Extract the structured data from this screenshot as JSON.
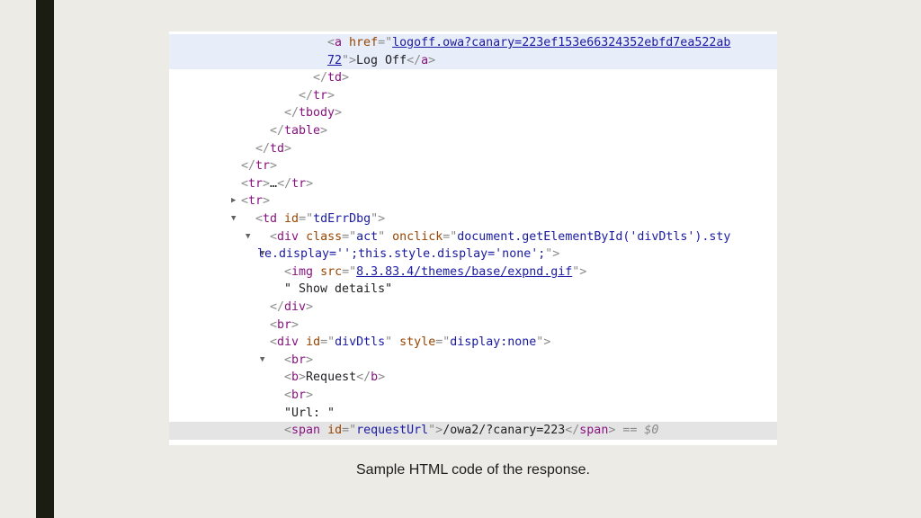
{
  "lines": {
    "l0": {
      "t1": "<",
      "name": "a",
      "sp": " ",
      "attr": "href",
      "eq": "=\"",
      "link": "logoff.owa?canary=223ef153e66324352ebfd7ea522ab",
      "q": "\""
    },
    "l1": {
      "link": "72",
      "q": "\">",
      "text": "Log Off",
      "close_open": "</",
      "name": "a",
      "close": ">"
    },
    "l2": {
      "open": "</",
      "name": "td",
      "close": ">"
    },
    "l3": {
      "open": "</",
      "name": "tr",
      "close": ">"
    },
    "l4": {
      "open": "</",
      "name": "tbody",
      "close": ">"
    },
    "l5": {
      "open": "</",
      "name": "table",
      "close": ">"
    },
    "l6": {
      "open": "</",
      "name": "td",
      "close": ">"
    },
    "l7": {
      "open": "</",
      "name": "tr",
      "close": ">"
    },
    "l8": {
      "open": "<",
      "name": "tr",
      "close": ">",
      "ellipsis": "…",
      "open2": "</",
      "name2": "tr",
      "close2": ">"
    },
    "l9": {
      "open": "<",
      "name": "tr",
      "close": ">"
    },
    "l10": {
      "open": "<",
      "name": "td",
      "attr": "id",
      "val": "tdErrDbg",
      "close": ">"
    },
    "l11": {
      "open": "<",
      "name": "div",
      "attr1": "class",
      "val1": "act",
      "attr2": "onclick",
      "val2": "document.getElementById('divDtls').sty"
    },
    "l12": {
      "val": "le.display='';this.style.display='none';",
      "close": "\">"
    },
    "l13": {
      "open": "<",
      "name": "img",
      "attr": "src",
      "link": "8.3.83.4/themes/base/expnd.gif",
      "close": ">"
    },
    "l14": {
      "text": "\" Show details\""
    },
    "l15": {
      "open": "</",
      "name": "div",
      "close": ">"
    },
    "l16": {
      "open": "<",
      "name": "br",
      "close": ">"
    },
    "l17": {
      "open": "<",
      "name": "div",
      "attr1": "id",
      "val1": "divDtls",
      "attr2": "style",
      "val2": "display:none",
      "close": ">"
    },
    "l18": {
      "open": "<",
      "name": "br",
      "close": ">"
    },
    "l19": {
      "open": "<",
      "name": "b",
      "close": ">",
      "text": "Request",
      "open2": "</",
      "name2": "b",
      "close2": ">"
    },
    "l20": {
      "open": "<",
      "name": "br",
      "close": ">"
    },
    "l21": {
      "text": "\"Url: \""
    },
    "l22": {
      "open": "<",
      "name": "span",
      "attr": "id",
      "val": "requestUrl",
      "close": ">",
      "text": "/owa2/?canary=223",
      "open2": "</",
      "name2": "span",
      "close2": ">",
      "extra": " == $0"
    }
  },
  "gutter_dots": "···",
  "arrows": {
    "collapsed": "▶",
    "expanded": "▼"
  },
  "caption": "Sample HTML code of the response."
}
